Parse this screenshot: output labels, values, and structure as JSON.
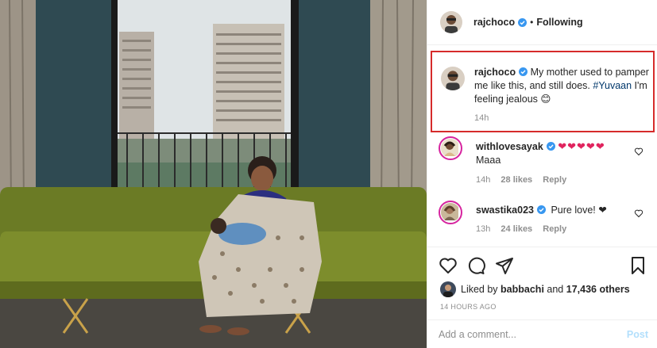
{
  "post": {
    "author": "rajchoco",
    "follow_status": "Following",
    "dot": "•"
  },
  "caption": {
    "username": "rajchoco",
    "text_before": "My mother used to pamper me like this, and still does.",
    "hashtag": "#Yuvaan",
    "text_after": "I'm feeling jealous 😊",
    "time": "14h"
  },
  "comments": [
    {
      "username": "withlovesayak",
      "text_inline": "❤❤❤❤❤",
      "text_second_line": "Maaa",
      "time": "14h",
      "likes": "28 likes",
      "reply": "Reply"
    },
    {
      "username": "swastika023",
      "text_inline": "Pure love! ❤",
      "time": "13h",
      "likes": "24 likes",
      "reply": "Reply"
    }
  ],
  "likes_line": {
    "prefix": "Liked by",
    "user": "babbachi",
    "conj": "and",
    "others": "17,436 others"
  },
  "posted": "14 HOURS AGO",
  "add_comment": {
    "placeholder": "Add a comment...",
    "post_label": "Post"
  },
  "icons": {
    "like": "heart-outline-icon",
    "comment": "comment-bubble-icon",
    "share": "paper-plane-icon",
    "save": "bookmark-icon",
    "verified": "verified-badge-icon"
  },
  "colors": {
    "verified": "#3897f0",
    "highlight_box": "#d62b2b",
    "heart": "#e0245e",
    "hashtag": "#00376b",
    "post_button": "#b2dffc"
  }
}
